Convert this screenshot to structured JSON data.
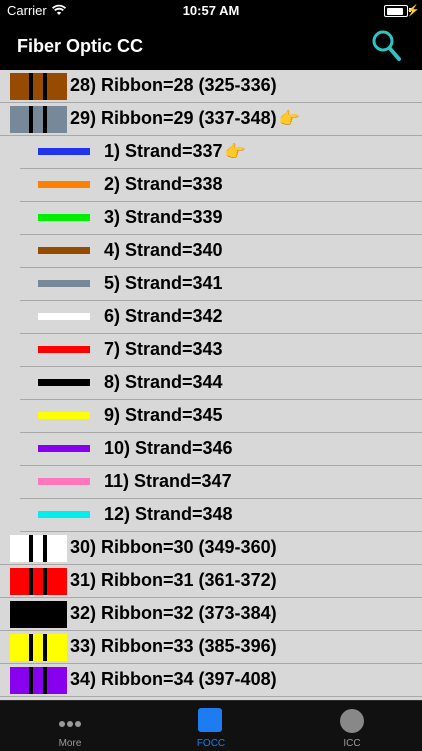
{
  "status_bar": {
    "carrier": "Carrier",
    "time": "10:57 AM"
  },
  "header": {
    "title": "Fiber Optic CC"
  },
  "rows": [
    {
      "type": "ribbon",
      "label": "28) Ribbon=28 (325-336)",
      "color": "#964B00",
      "pointer": false
    },
    {
      "type": "ribbon",
      "label": "29) Ribbon=29 (337-348)",
      "color": "#778899",
      "pointer": true
    },
    {
      "type": "strand",
      "label": "1) Strand=337",
      "color": "#2233ee",
      "pointer": true
    },
    {
      "type": "strand",
      "label": "2) Strand=338",
      "color": "#ff8000",
      "pointer": false
    },
    {
      "type": "strand",
      "label": "3) Strand=339",
      "color": "#00ee00",
      "pointer": false
    },
    {
      "type": "strand",
      "label": "4) Strand=340",
      "color": "#964B00",
      "pointer": false
    },
    {
      "type": "strand",
      "label": "5) Strand=341",
      "color": "#778899",
      "pointer": false
    },
    {
      "type": "strand",
      "label": "6) Strand=342",
      "color": "#ffffff",
      "pointer": false
    },
    {
      "type": "strand",
      "label": "7) Strand=343",
      "color": "#ff0000",
      "pointer": false
    },
    {
      "type": "strand",
      "label": "8) Strand=344",
      "color": "#000000",
      "pointer": false
    },
    {
      "type": "strand",
      "label": "9) Strand=345",
      "color": "#ffff00",
      "pointer": false
    },
    {
      "type": "strand",
      "label": "10) Strand=346",
      "color": "#8800ee",
      "pointer": false
    },
    {
      "type": "strand",
      "label": "11) Strand=347",
      "color": "#ff77bb",
      "pointer": false
    },
    {
      "type": "strand",
      "label": "12) Strand=348",
      "color": "#00eeee",
      "pointer": false
    },
    {
      "type": "ribbon",
      "label": "30) Ribbon=30 (349-360)",
      "color": "#ffffff",
      "pointer": false
    },
    {
      "type": "ribbon",
      "label": "31) Ribbon=31 (361-372)",
      "color": "#ff0000",
      "pointer": false
    },
    {
      "type": "ribbon",
      "label": "32) Ribbon=32 (373-384)",
      "color": "#000000",
      "pointer": false
    },
    {
      "type": "ribbon",
      "label": "33) Ribbon=33 (385-396)",
      "color": "#ffff00",
      "pointer": false
    },
    {
      "type": "ribbon",
      "label": "34) Ribbon=34 (397-408)",
      "color": "#8800ee",
      "pointer": false
    }
  ],
  "tabs": [
    {
      "label": "More",
      "icon": "more-dots-icon",
      "active": false
    },
    {
      "label": "FOCC",
      "icon": "focc-square-icon",
      "active": true
    },
    {
      "label": "ICC",
      "icon": "icc-circle-icon",
      "active": false
    }
  ],
  "colors": {
    "accent": "#1e7cf2",
    "search": "#2ec4c4"
  }
}
